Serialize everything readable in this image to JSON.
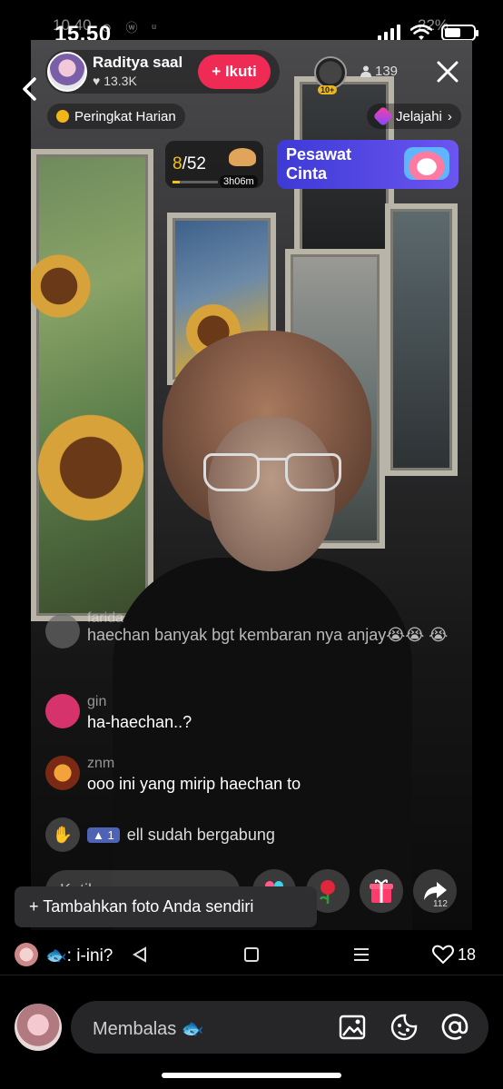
{
  "status_bar": {
    "time": "15.50",
    "ghost_time": "10.40",
    "ghost_icons": "⊙ ⓦ ᵘ",
    "ghost_battery": "22%",
    "battery_level": 0.55
  },
  "host": {
    "name": "Raditya saal",
    "likes": "13.3K",
    "follow_label": "+ Ikuti"
  },
  "top_viewer_badge": "10+",
  "viewer_count": "139",
  "pills": {
    "ranking": "Peringkat Harian",
    "explore": "Jelajahi"
  },
  "goal": {
    "current": "8",
    "total": "/52",
    "timer": "3h06m",
    "progress": 0.15
  },
  "event": {
    "title": "Pesawat Cinta"
  },
  "chat": [
    {
      "user": "farida",
      "message": "haechan banyak bgt kembaran nya anjay😭😭 😭",
      "avatar_color": "#6a6a6a"
    },
    {
      "user": "gin",
      "message": "ha-haechan..?",
      "avatar_color": "#d6336c"
    },
    {
      "user": "znm",
      "message": "ooo ini yang mirip haechan to",
      "avatar_color": "#b4502a"
    }
  ],
  "joined": {
    "level": "1",
    "text": "ell sudah bergabung"
  },
  "input": {
    "placeholder": "Ketik..."
  },
  "share_count": "112",
  "add_photo_label": "+ Tambahkan foto Anda sendiri",
  "reply": {
    "text": ": i-ini?",
    "heart_count": "18"
  },
  "composer": {
    "placeholder": "Membalas 🐟"
  },
  "colors": {
    "follow": "#ef2a55",
    "event": "#4f45e0",
    "goal": "#f2c01b"
  }
}
